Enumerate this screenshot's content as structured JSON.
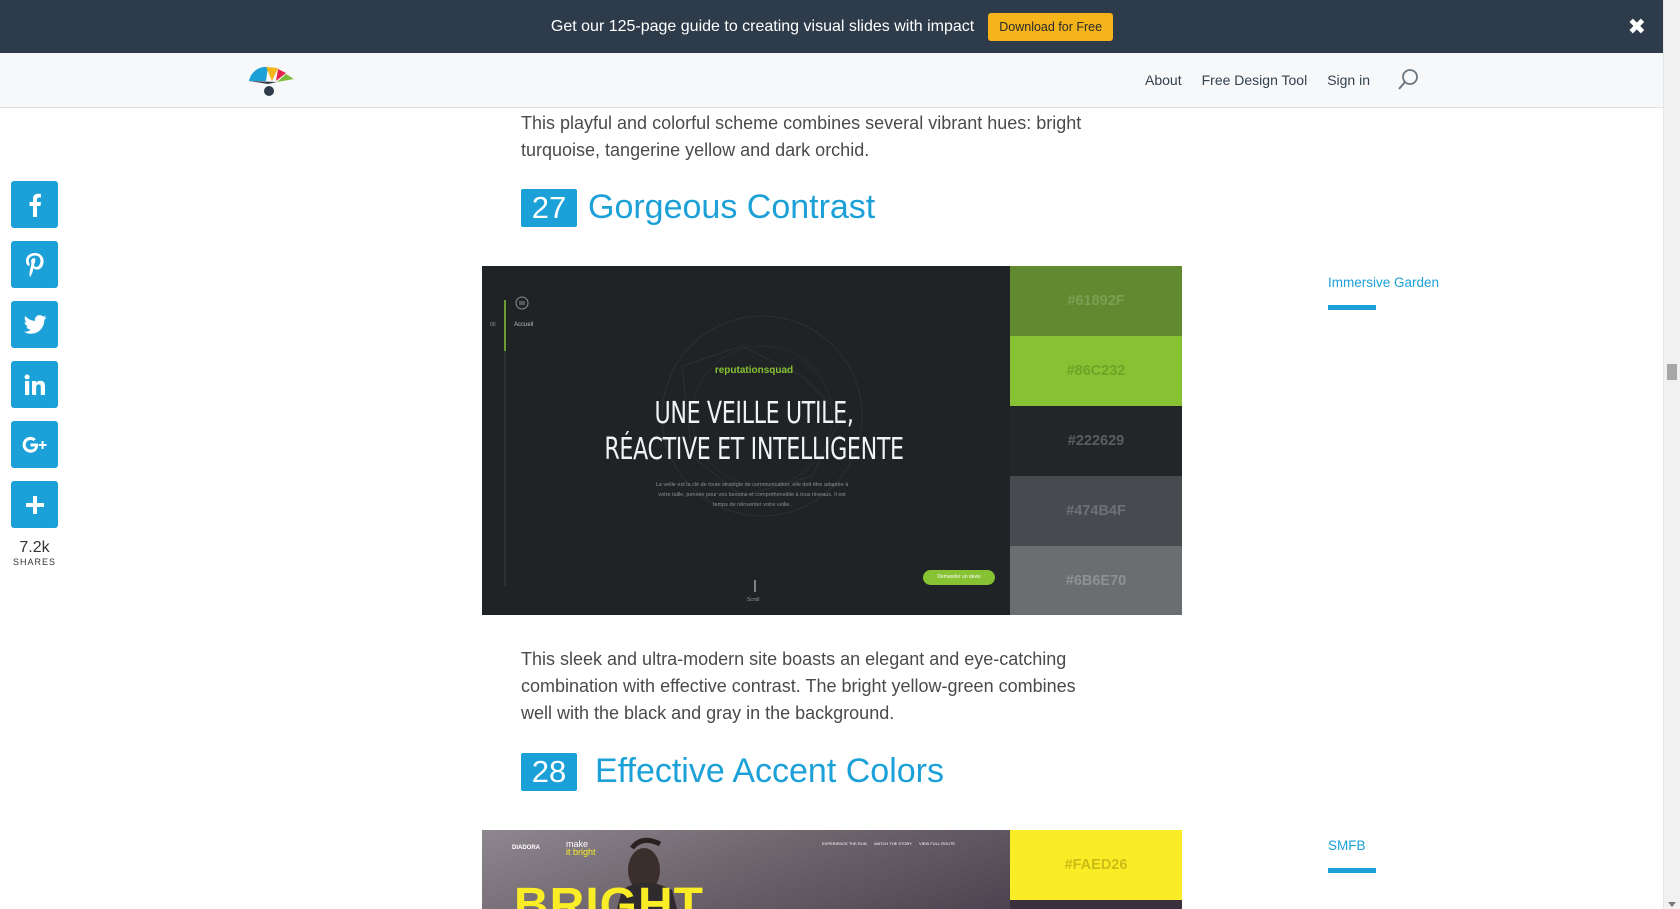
{
  "promo": {
    "text": "Get our 125-page guide to creating visual slides with impact",
    "button": "Download for Free",
    "close": "✖"
  },
  "nav": {
    "links": [
      "About",
      "Free Design Tool",
      "Sign in"
    ]
  },
  "social": {
    "buttons": [
      {
        "icon": "facebook-icon",
        "glyph": "f"
      },
      {
        "icon": "pinterest-icon",
        "glyph": "P"
      },
      {
        "icon": "twitter-icon",
        "glyph": "t"
      },
      {
        "icon": "linkedin-icon",
        "glyph": "in"
      },
      {
        "icon": "google-plus-icon",
        "glyph": "G+"
      },
      {
        "icon": "plus-icon",
        "glyph": "+"
      }
    ],
    "count": "7.2k",
    "count_label": "SHARES"
  },
  "article": {
    "intro": "This playful and colorful scheme combines several vibrant hues: bright turquoise, tangerine yellow and dark orchid.",
    "section27": {
      "number": "27",
      "title": "Gorgeous Contrast",
      "site": {
        "menu_num": "00",
        "menu_label": "Accueil",
        "brand": "reputationsquad",
        "headline_1": "UNE VEILLE UTILE,",
        "headline_2": "RÉACTIVE ET INTELLIGENTE",
        "body": "La veille est la clé de toute stratégie de communication, elle doit être adaptée à votre taille, pensée pour vos besoins et compréhensible à tous niveaux. Il est temps de réinventer votre veille.",
        "cta": "Demander un devis",
        "scroll": "Scroll"
      },
      "swatches": [
        {
          "hex": "#61892F",
          "text_color": "#7d9e55"
        },
        {
          "hex": "#86C232",
          "text_color": "#6ea328"
        },
        {
          "hex": "#222629",
          "text_color": "#5a5e61"
        },
        {
          "hex": "#474B4F",
          "text_color": "#6d7175"
        },
        {
          "hex": "#6B6E70",
          "text_color": "#8e9193"
        }
      ],
      "description": "This sleek and ultra-modern site boasts an elegant and eye-catching combination with effective contrast. The bright yellow-green combines well with the black and gray in the background."
    },
    "section28": {
      "number": "28",
      "title": "Effective Accent Colors",
      "site": {
        "brand": "DIADORA",
        "tagline_1": "make",
        "tagline_2": "it bright",
        "nav": [
          "EXPERIENCE THE RUN",
          "WATCH THE STORY",
          "VIEW FULL ROUTE"
        ],
        "headline": "BRIGHT"
      },
      "swatches": [
        {
          "hex": "#FAED26",
          "text_color": "#c9bd16"
        }
      ]
    }
  },
  "sidebar": {
    "link1": "Immersive Garden",
    "link2": "SMFB"
  }
}
